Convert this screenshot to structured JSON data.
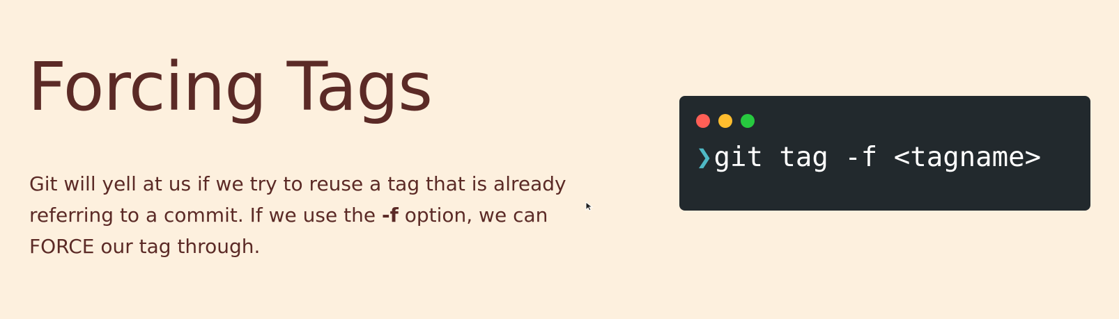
{
  "slide": {
    "title": "Forcing Tags",
    "body": {
      "before_flag": "Git will yell at us if we try to reuse a tag that is already referring to a commit. If we use the ",
      "flag": "-f",
      "after_flag": " option, we can FORCE our tag through."
    }
  },
  "terminal": {
    "prompt_symbol": "❯",
    "command": "git tag -f <tagname>",
    "dots": {
      "close": "#ff5f56",
      "minimize": "#ffbd2e",
      "maximize": "#27c93f"
    },
    "prompt_color": "#4fb8c4"
  },
  "colors": {
    "background": "#fdf0de",
    "text": "#5b2a26",
    "terminal_bg": "#22292d"
  }
}
